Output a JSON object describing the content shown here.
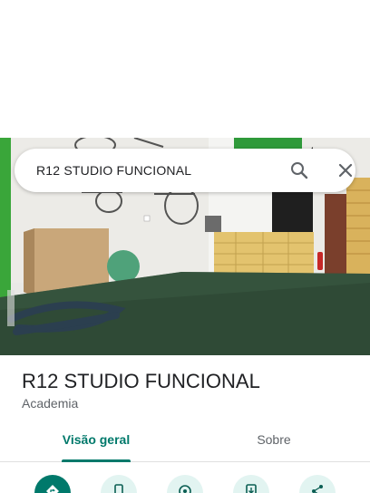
{
  "search": {
    "query": "R12 STUDIO FUNCIONAL"
  },
  "place": {
    "title": "R12 STUDIO FUNCIONAL",
    "category": "Academia"
  },
  "tabs": [
    {
      "label": "Visão geral",
      "selected": true
    },
    {
      "label": "Sobre",
      "selected": false
    }
  ],
  "actions": [
    {
      "icon": "directions-icon",
      "primary": true
    },
    {
      "icon": "phone-icon",
      "primary": false
    },
    {
      "icon": "location-icon",
      "primary": false
    },
    {
      "icon": "add-to-phone-icon",
      "primary": false
    },
    {
      "icon": "share-icon",
      "primary": false
    }
  ],
  "colors": {
    "accent": "#00796b",
    "action_bg": "#e2f4f1",
    "text_primary": "#202124",
    "text_secondary": "#5f6368"
  }
}
